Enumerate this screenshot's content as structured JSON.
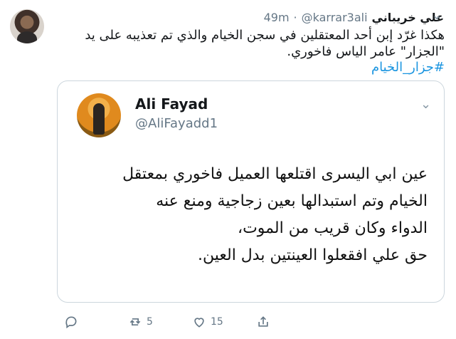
{
  "tweet": {
    "author_name": "علي خريباني",
    "handle": "@karrar3ali",
    "separator": "·",
    "time": "49m",
    "text": "هكذا غرّد إبن أحد المعتقلين في سجن الخيام والذي تم تعذيبه على يد \"الجزار\" عامر الياس فاخوري.",
    "hashtag": "#جزار_الخيام"
  },
  "quoted": {
    "name": "Ali Fayad",
    "handle": "@AliFayadd1",
    "lines": [
      "عين ابي اليسرى اقتلعها العميل فاخوري بمعتقل",
      "الخيام وتم استبدالها بعين زجاجية ومنع عنه",
      "الدواء وكان قريب من الموت،",
      "حق علي افقعلوا العينتين بدل العين."
    ]
  },
  "actions": {
    "reply_count": "",
    "retweet_count": "5",
    "like_count": "15"
  },
  "icons": {
    "reply": "reply-icon",
    "retweet": "retweet-icon",
    "like": "heart-icon",
    "share": "share-icon",
    "menu": "chevron-down-icon"
  },
  "colors": {
    "link": "#1b95e0",
    "secondary_text": "#657786",
    "border": "#ccd6dd"
  }
}
